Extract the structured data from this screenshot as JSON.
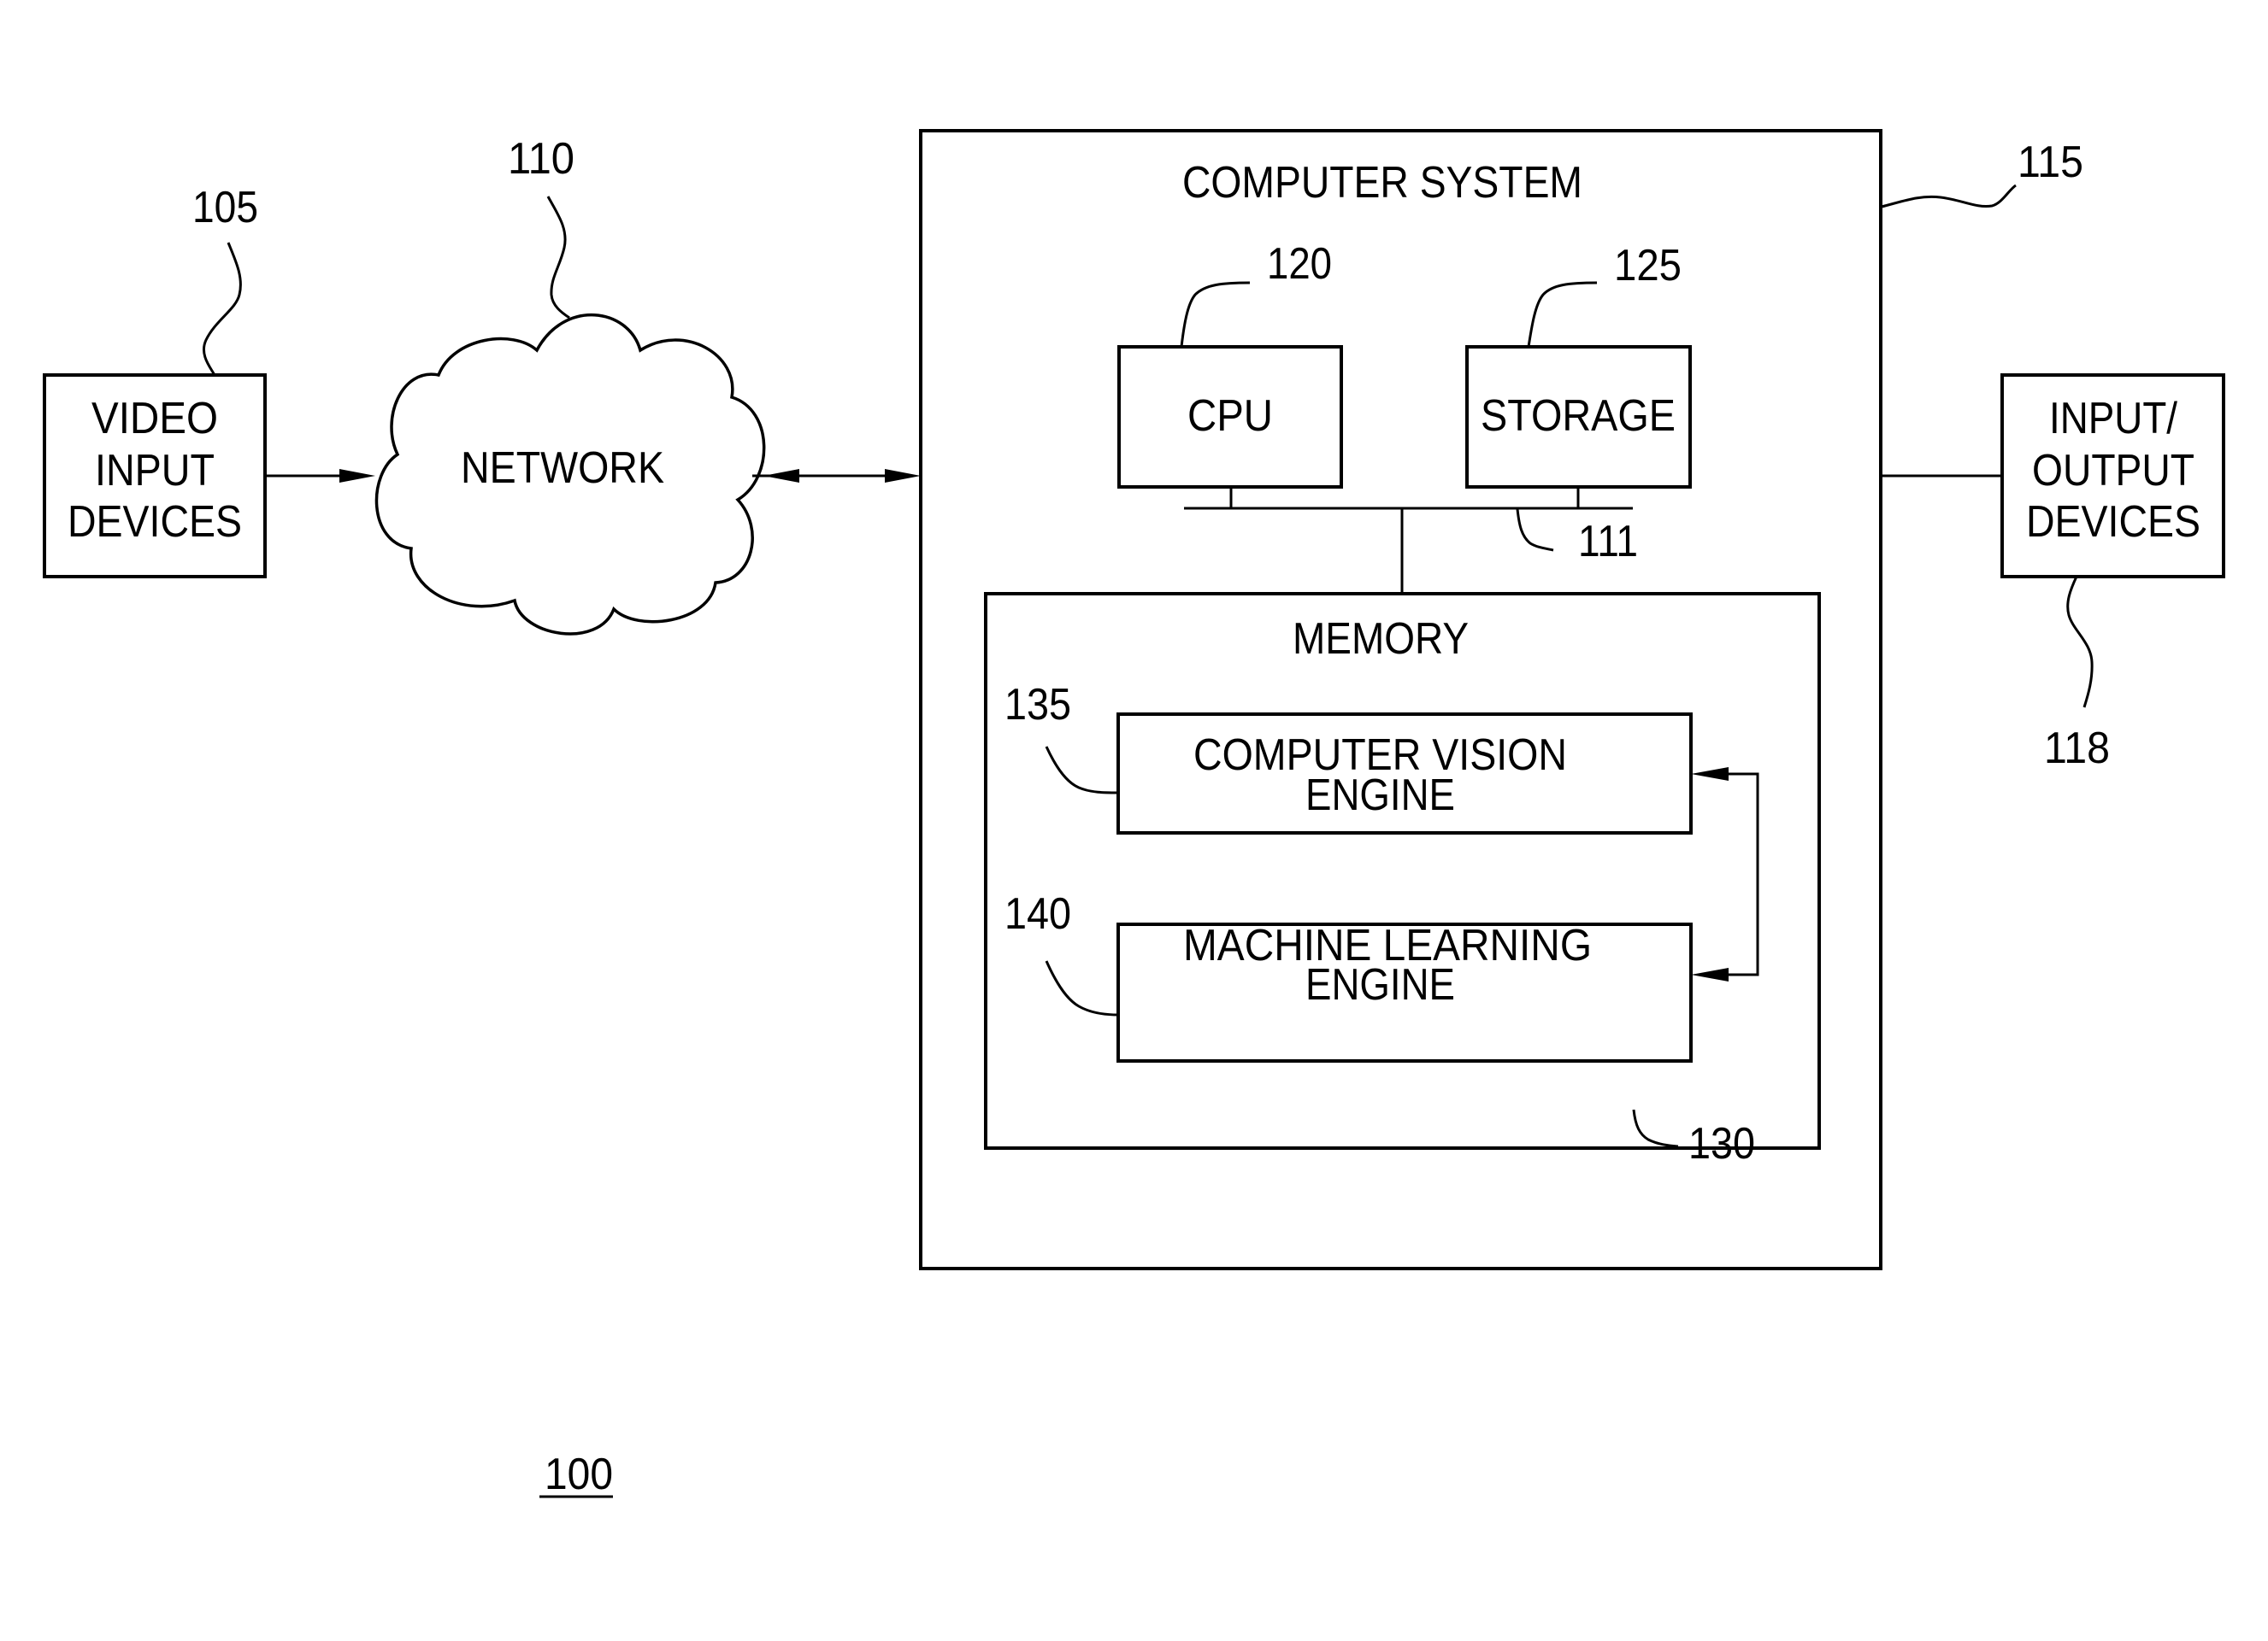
{
  "figure_number": "100",
  "nodes": {
    "video_input": {
      "ref": "105",
      "lines": [
        "VIDEO",
        "INPUT",
        "DEVICES"
      ]
    },
    "network": {
      "ref": "110",
      "label": "NETWORK"
    },
    "computer_system": {
      "ref": "115",
      "label": "COMPUTER SYSTEM"
    },
    "io_devices": {
      "ref": "118",
      "lines": [
        "INPUT/",
        "OUTPUT",
        "DEVICES"
      ]
    },
    "bus": {
      "ref": "111"
    },
    "cpu": {
      "ref": "120",
      "label": "CPU"
    },
    "storage": {
      "ref": "125",
      "label": "STORAGE"
    },
    "memory": {
      "ref": "130",
      "label": "MEMORY"
    },
    "cv_engine": {
      "ref": "135",
      "lines": [
        "COMPUTER VISION",
        "ENGINE"
      ]
    },
    "ml_engine": {
      "ref": "140",
      "lines": [
        "MACHINE LEARNING",
        "ENGINE"
      ]
    }
  },
  "connections": [
    {
      "from": "video_input",
      "to": "network",
      "type": "arrow"
    },
    {
      "from": "network",
      "to": "computer_system",
      "type": "bidirectional-arrow"
    },
    {
      "from": "computer_system",
      "to": "io_devices",
      "type": "line"
    },
    {
      "from": "cpu",
      "to": "bus",
      "type": "line"
    },
    {
      "from": "storage",
      "to": "bus",
      "type": "line"
    },
    {
      "from": "bus",
      "to": "memory",
      "type": "line"
    },
    {
      "from": "cv_engine",
      "to": "ml_engine",
      "type": "bidirectional-arrow"
    }
  ],
  "colors": {
    "stroke": "#000000",
    "background": "#ffffff"
  }
}
